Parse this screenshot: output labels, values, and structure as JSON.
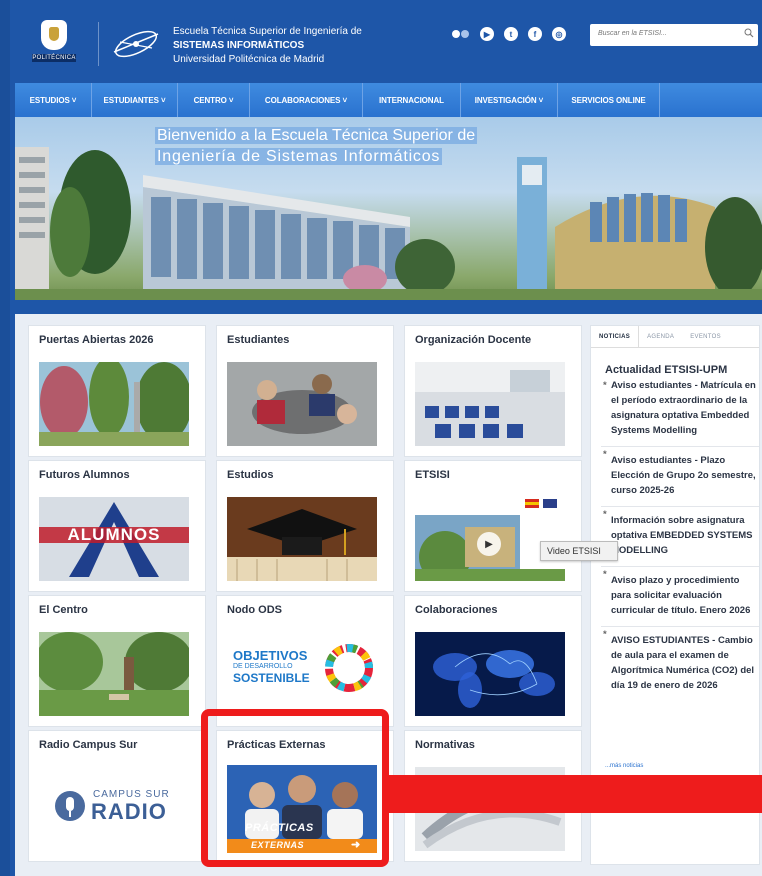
{
  "header": {
    "upm_label": "POLITÉCNICA",
    "school_line1": "Escuela Técnica Superior de Ingeniería de",
    "school_line2": "SISTEMAS INFORMÁTICOS",
    "school_line3": "Universidad Politécnica de Madrid",
    "social_icons": [
      "flickr-icon",
      "youtube-icon",
      "twitter-icon",
      "facebook-icon",
      "instagram-icon"
    ],
    "search_placeholder": "Buscar en la ETSISI..."
  },
  "nav": {
    "items": [
      {
        "label": "ESTUDIOS ˅"
      },
      {
        "label": "ESTUDIANTES ˅"
      },
      {
        "label": "CENTRO ˅"
      },
      {
        "label": "COLABORACIONES ˅"
      },
      {
        "label": "INTERNACIONAL"
      },
      {
        "label": "INVESTIGACIÓN ˅"
      },
      {
        "label": "SERVICIOS ONLINE"
      }
    ]
  },
  "banner": {
    "line1": "Bienvenido a la Escuela Técnica Superior de",
    "line2": "Ingeniería de Sistemas Informáticos"
  },
  "cards": {
    "puertas": {
      "title": "Puertas Abiertas 2026"
    },
    "estudiantes": {
      "title": "Estudiantes"
    },
    "organizacion": {
      "title": "Organización Docente"
    },
    "futuros": {
      "title": "Futuros Alumnos",
      "image_text": "ALUMNOS"
    },
    "estudios": {
      "title": "Estudios"
    },
    "etsisi": {
      "title": "ETSISI"
    },
    "centro": {
      "title": "El Centro"
    },
    "ods": {
      "title": "Nodo ODS",
      "line1": "OBJETIVOS",
      "line2": "DE DESARROLLO",
      "line3": "SOSTENIBLE"
    },
    "colaboraciones": {
      "title": "Colaboraciones"
    },
    "radio": {
      "title": "Radio Campus Sur",
      "line1": "CAMPUS SUR",
      "line2": "RADIO"
    },
    "practicas": {
      "title": "Prácticas Externas",
      "line1": "PRÁCTICAS",
      "line2": "EXTERNAS"
    },
    "normativas": {
      "title": "Normativas"
    }
  },
  "tooltip": "Video ETSISI",
  "news": {
    "tabs": [
      "NOTICIAS",
      "AGENDA",
      "EVENTOS"
    ],
    "heading": "Actualidad ETSISI-UPM",
    "entries": [
      "Aviso estudiantes - Matrícula en el período extraordinario de la asignatura optativa Embedded Systems Modelling",
      "Aviso estudiantes - Plazo Elección de Grupo 2o semestre, curso 2025-26",
      "Información sobre asignatura optativa EMBEDDED SYSTEMS MODELLING",
      "Aviso plazo y procedimiento para solicitar evaluación curricular de título. Enero 2026",
      "AVISO ESTUDIANTES - Cambio de aula para el examen de Algorítmica Numérica (CO2) del día 19 de enero de 2026"
    ],
    "more": "...más noticias"
  },
  "colors": {
    "header_blue": "#1e56a8",
    "nav_blue": "#2a72cf",
    "highlight_red": "#ee1c1c"
  }
}
